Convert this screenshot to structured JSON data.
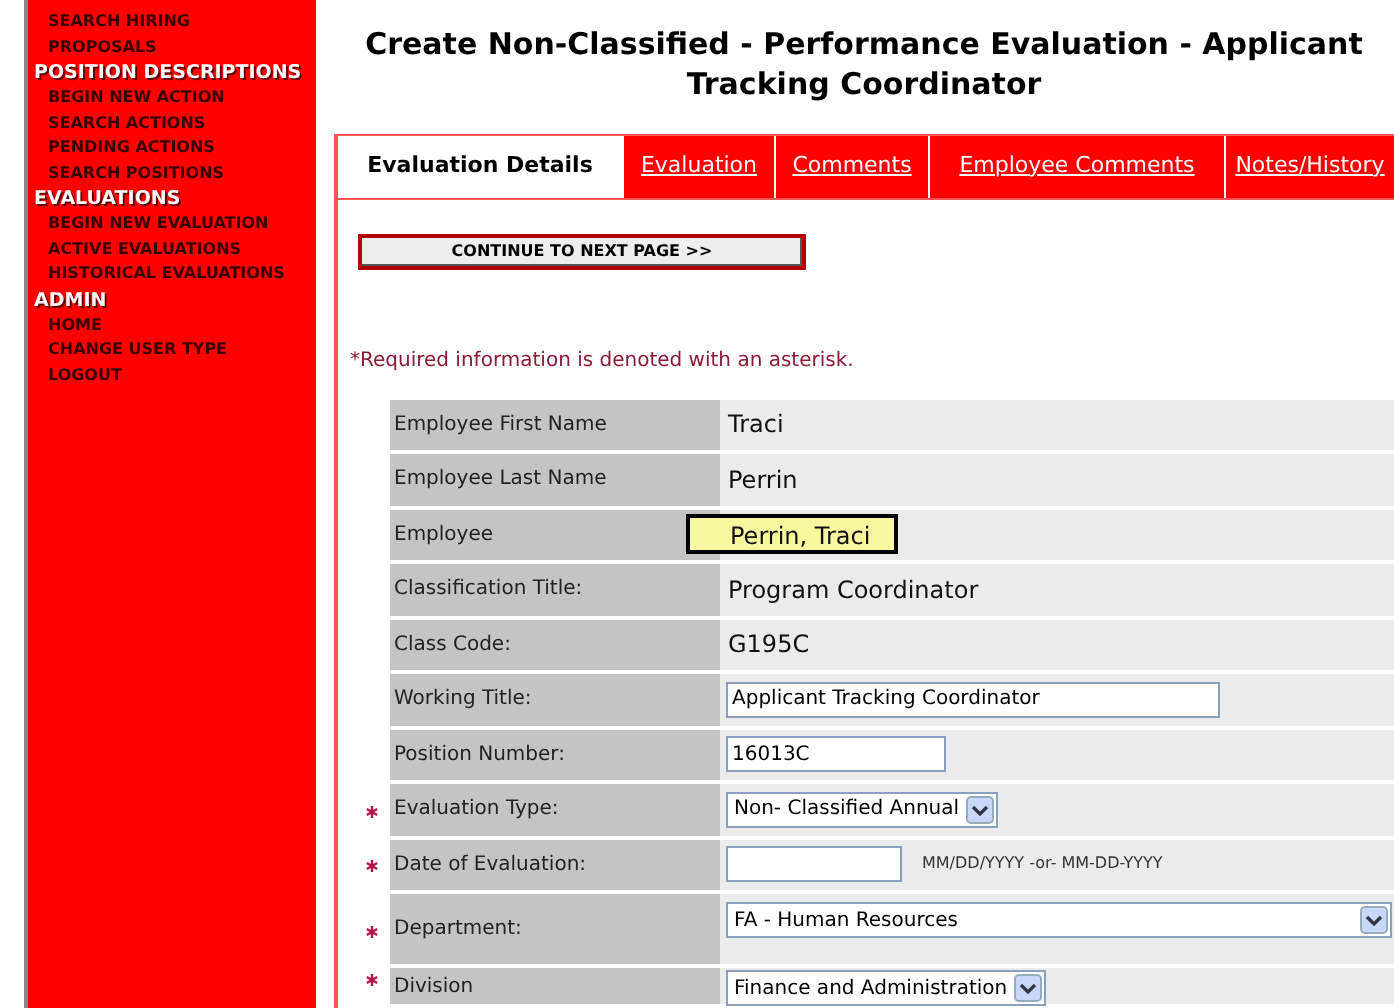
{
  "sidebar": {
    "items": [
      {
        "kind": "link",
        "label": "SEARCH HIRING PROPOSALS"
      },
      {
        "kind": "header",
        "label": "POSITION DESCRIPTIONS"
      },
      {
        "kind": "link",
        "label": "BEGIN NEW ACTION"
      },
      {
        "kind": "link",
        "label": "SEARCH ACTIONS"
      },
      {
        "kind": "link",
        "label": "PENDING ACTIONS"
      },
      {
        "kind": "link",
        "label": "SEARCH POSITIONS"
      },
      {
        "kind": "header",
        "label": "EVALUATIONS"
      },
      {
        "kind": "link",
        "label": "BEGIN NEW EVALUATION"
      },
      {
        "kind": "link",
        "label": "ACTIVE EVALUATIONS"
      },
      {
        "kind": "link",
        "label": "HISTORICAL EVALUATIONS"
      },
      {
        "kind": "header",
        "label": "ADMIN"
      },
      {
        "kind": "link",
        "label": "HOME"
      },
      {
        "kind": "link",
        "label": "CHANGE USER TYPE"
      },
      {
        "kind": "link",
        "label": "LOGOUT"
      }
    ]
  },
  "page_title": "Create Non-Classified - Performance Evaluation - Applicant Tracking Coordinator",
  "tabs": [
    {
      "label": "Evaluation Details",
      "selected": true
    },
    {
      "label": "Evaluation",
      "selected": false
    },
    {
      "label": "Comments",
      "selected": false
    },
    {
      "label": "Employee Comments",
      "selected": false
    },
    {
      "label": "Notes/History",
      "selected": false
    }
  ],
  "continue_button": "CONTINUE TO NEXT PAGE >>",
  "required_note": "*Required information is denoted with an asterisk.",
  "form": {
    "rows": [
      {
        "label": "Employee First Name",
        "required": false,
        "kind": "text",
        "value": "Traci"
      },
      {
        "label": "Employee Last Name",
        "required": false,
        "kind": "text",
        "value": "Perrin"
      },
      {
        "label": "Employee",
        "required": false,
        "kind": "highlighted",
        "value": "Perrin, Traci"
      },
      {
        "label": "Classification Title:",
        "required": false,
        "kind": "text",
        "value": "Program Coordinator"
      },
      {
        "label": "Class Code:",
        "required": false,
        "kind": "text",
        "value": "G195C"
      },
      {
        "label": "Working Title:",
        "required": false,
        "kind": "input",
        "value": "Applicant Tracking Coordinator"
      },
      {
        "label": "Position Number:",
        "required": false,
        "kind": "short_input",
        "value": "16013C"
      },
      {
        "label": "Evaluation Type:",
        "required": true,
        "kind": "select",
        "value": "Non- Classified Annual"
      },
      {
        "label": "Date of Evaluation:",
        "required": true,
        "kind": "date",
        "value": "",
        "hint": "MM/DD/YYYY -or- MM-DD-YYYY"
      },
      {
        "label": "Department:",
        "required": true,
        "kind": "wide_select",
        "value": "FA - Human Resources"
      },
      {
        "label": "Division",
        "required": true,
        "kind": "select",
        "value": "Finance and Administration"
      }
    ]
  }
}
